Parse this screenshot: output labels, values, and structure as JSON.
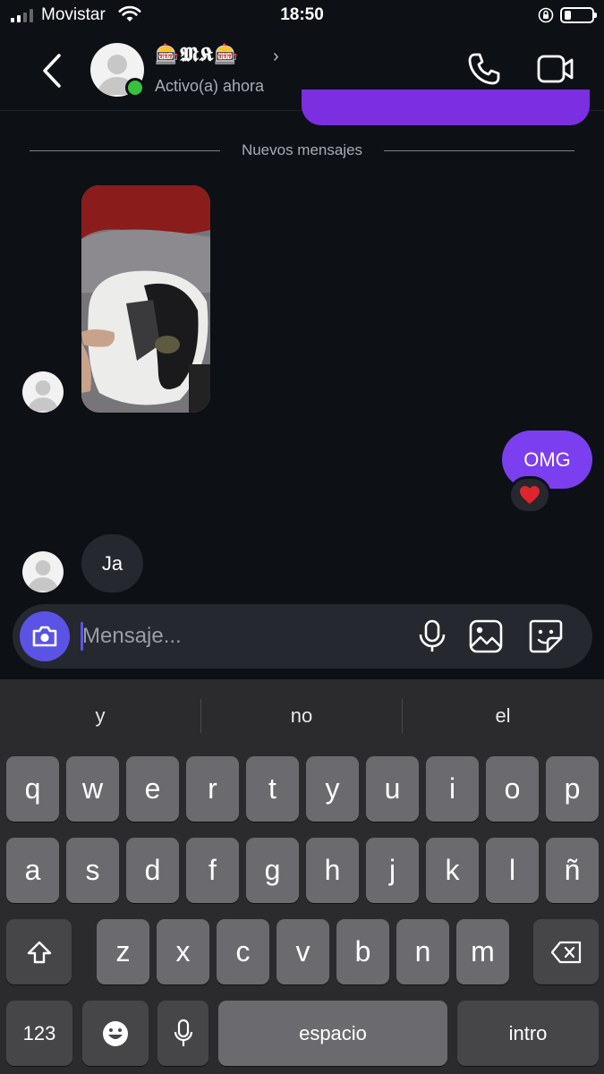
{
  "status_bar": {
    "carrier": "Movistar",
    "time": "18:50"
  },
  "header": {
    "contact_name": "🎰𝕸𝕶🎰",
    "contact_status": "Activo(a) ahora"
  },
  "chat": {
    "separator_label": "Nuevos mensajes",
    "messages": [
      {
        "direction": "incoming",
        "type": "photo"
      },
      {
        "direction": "outgoing",
        "type": "text",
        "text": "OMG",
        "reaction": "❤️"
      },
      {
        "direction": "incoming",
        "type": "text",
        "text": "Ja"
      }
    ]
  },
  "composer": {
    "placeholder": "Mensaje..."
  },
  "keyboard": {
    "suggestions": [
      "y",
      "no",
      "el"
    ],
    "row1": [
      "q",
      "w",
      "e",
      "r",
      "t",
      "y",
      "u",
      "i",
      "o",
      "p"
    ],
    "row2": [
      "a",
      "s",
      "d",
      "f",
      "g",
      "h",
      "j",
      "k",
      "l",
      "ñ"
    ],
    "row3": [
      "z",
      "x",
      "c",
      "v",
      "b",
      "n",
      "m"
    ],
    "numbers_key": "123",
    "space_key": "espacio",
    "return_key": "intro"
  },
  "colors": {
    "background": "#0d1015",
    "outgoing_bubble": "#7b3ff0",
    "incoming_bubble": "#25282e",
    "online": "#38c23c",
    "camera_button": "#5a53e6"
  }
}
